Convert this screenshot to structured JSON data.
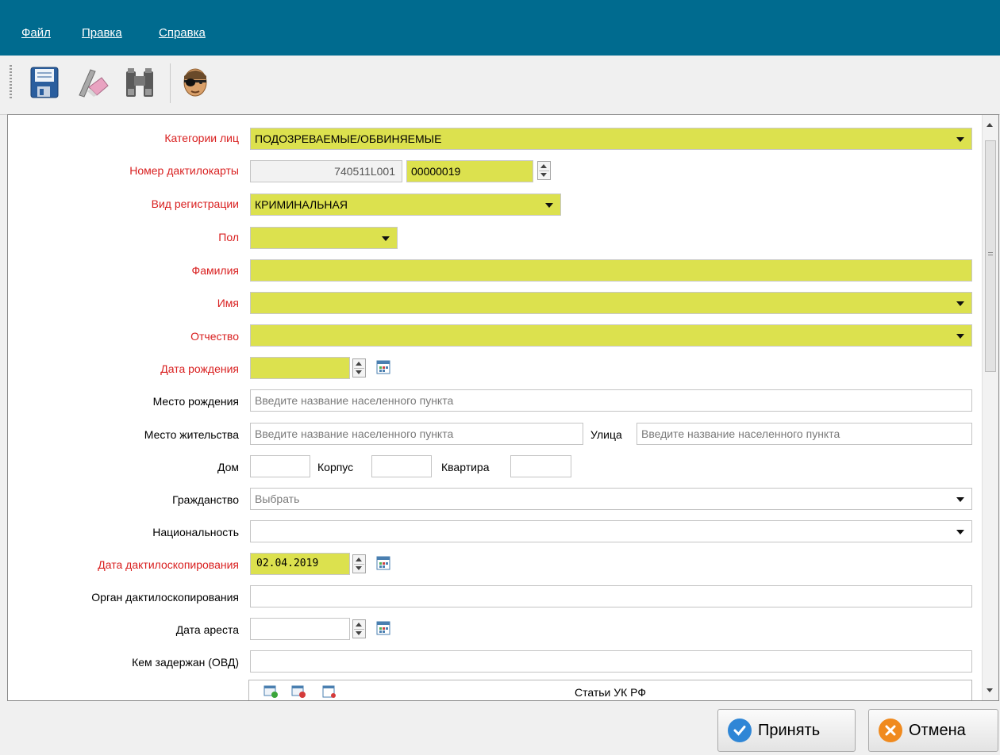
{
  "menu": [
    "Файл",
    "Правка",
    "Справка"
  ],
  "toolbar": {
    "buttons": [
      {
        "name": "save-icon"
      },
      {
        "name": "edit-eraser-icon"
      },
      {
        "name": "binoculars-icon"
      },
      {
        "name": "agent-avatar-icon"
      }
    ]
  },
  "form": {
    "category": {
      "label": "Категории лиц",
      "value": "ПОДОЗРЕВАЕМЫЕ/ОБВИНЯЕМЫЕ"
    },
    "card_number": {
      "label": "Номер дактилокарты",
      "prefix": "740511L001",
      "value": "00000019"
    },
    "registration_type": {
      "label": "Вид регистрации",
      "value": "КРИМИНАЛЬНАЯ"
    },
    "sex": {
      "label": "Пол",
      "value": ""
    },
    "surname": {
      "label": "Фамилия",
      "value": ""
    },
    "name": {
      "label": "Имя",
      "value": ""
    },
    "patronymic": {
      "label": "Отчество",
      "value": ""
    },
    "birth_date": {
      "label": "Дата рождения",
      "value": " .  . "
    },
    "birth_place": {
      "label": "Место рождения",
      "placeholder": "Введите название населенного пункта"
    },
    "residence": {
      "label": "Место жительства",
      "placeholder": "Введите название населенного пункта"
    },
    "street": {
      "label": "Улица",
      "placeholder": "Введите название населенного пункта"
    },
    "house": {
      "label": "Дом"
    },
    "building": {
      "label": "Корпус"
    },
    "apartment": {
      "label": "Квартира"
    },
    "citizenship": {
      "label": "Гражданство",
      "placeholder": "Выбрать"
    },
    "nationality": {
      "label": "Национальность",
      "value": ""
    },
    "fingerprint_date": {
      "label": "Дата дактилоскопирования",
      "value": "02.04.2019"
    },
    "fingerprint_agency": {
      "label": "Орган дактилоскопирования",
      "value": ""
    },
    "arrest_date": {
      "label": "Дата ареста",
      "value": " .  . "
    },
    "detained_by": {
      "label": "Кем задержан (ОВД)",
      "value": ""
    },
    "articles": {
      "title": "Статьи УК РФ"
    }
  },
  "buttons": {
    "accept": "Принять",
    "cancel": "Отмена"
  },
  "colors": {
    "menubar": "#006b8f",
    "required_label": "#d92020",
    "required_field": "#dce14e"
  }
}
